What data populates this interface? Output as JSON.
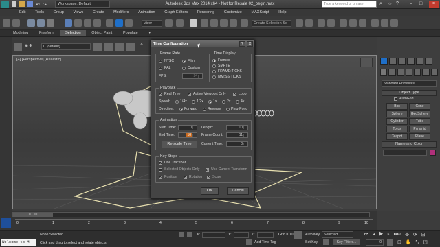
{
  "window": {
    "title": "Autodesk 3ds Max 2014 x64 - Not for Resale 02_begin.max",
    "workspace": "Workspace: Default",
    "search_placeholder": "Type a keyword or phrase"
  },
  "menu": [
    "Edit",
    "Tools",
    "Group",
    "Views",
    "Create",
    "Modifiers",
    "Animation",
    "Graph Editors",
    "Rendering",
    "Customize",
    "MAXScript",
    "Help"
  ],
  "toolbar": {
    "view_dropdown": "View",
    "selection_set": "Create Selection Se"
  },
  "ribbon": {
    "tabs": [
      "Modeling",
      "Freeform",
      "Selection",
      "Object Paint",
      "Populate"
    ]
  },
  "layer": {
    "label": "0 (default)"
  },
  "viewport": {
    "label": "[+] [Perspective] [Realistic]"
  },
  "command_panel": {
    "dropdown": "Standard Primitives",
    "object_type_title": "Object Type",
    "autogrid": "AutoGrid",
    "buttons": [
      "Box",
      "Cone",
      "Sphere",
      "GeoSphere",
      "Cylinder",
      "Tube",
      "Torus",
      "Pyramid",
      "Teapot",
      "Plane"
    ],
    "name_color_title": "Name and Color"
  },
  "timeline": {
    "frame_readout": "0 / 10",
    "ticks": [
      "0",
      "1",
      "2",
      "3",
      "4",
      "5",
      "6",
      "7",
      "8",
      "9",
      "10"
    ]
  },
  "status": {
    "maxscript": "Welcome to M",
    "selection": "None Selected",
    "prompt": "Click and drag to select and rotate objects",
    "x_label": "X:",
    "y_label": "Y:",
    "z_label": "Z:",
    "grid": "Grid = 10.0",
    "add_time_tag": "Add Time Tag",
    "auto_key": "Auto Key",
    "set_key": "Set Key",
    "key_mode": "Selected",
    "key_filters": "Key Filters...",
    "frame": "0"
  },
  "dialog": {
    "title": "Time Configuration",
    "help_btn": "?",
    "close_btn": "X",
    "frame_rate": {
      "title": "Frame Rate",
      "options": [
        "NTSC",
        "Film",
        "PAL",
        "Custom"
      ],
      "selected": "Film",
      "fps_label": "FPS:",
      "fps_value": "24"
    },
    "time_display": {
      "title": "Time Display",
      "options": [
        "Frames",
        "SMPTE",
        "FRAME:TICKS",
        "MM:SS:TICKS"
      ],
      "selected": "Frames"
    },
    "playback": {
      "title": "Playback",
      "real_time": "Real Time",
      "active_viewport": "Active Viewport Only",
      "loop": "Loop",
      "speed_label": "Speed:",
      "speeds": [
        "1/4x",
        "1/2x",
        "1x",
        "2x",
        "4x"
      ],
      "speed_selected": "1x",
      "direction_label": "Direction:",
      "directions": [
        "Forward",
        "Reverse",
        "Ping-Pong"
      ],
      "direction_selected": "Forward"
    },
    "animation": {
      "title": "Animation",
      "start_label": "Start Time:",
      "start_value": "0",
      "end_label": "End Time:",
      "end_value": "10",
      "length_label": "Length:",
      "length_value": "10",
      "frame_count_label": "Frame Count:",
      "frame_count_value": "11",
      "rescale_btn": "Re-scale Time",
      "current_label": "Current Time:",
      "current_value": "0"
    },
    "key_steps": {
      "title": "Key Steps",
      "use_trackbar": "Use TrackBar",
      "selected_only": "Selected Objects Only",
      "use_current_transform": "Use Current Transform",
      "position": "Position",
      "rotation": "Rotation",
      "scale": "Scale"
    },
    "ok": "OK",
    "cancel": "Cancel"
  },
  "colors": {
    "accent": "#1f6fc8",
    "end_time_highlight": "#c8691e",
    "name_swatch": "#b0307a"
  }
}
